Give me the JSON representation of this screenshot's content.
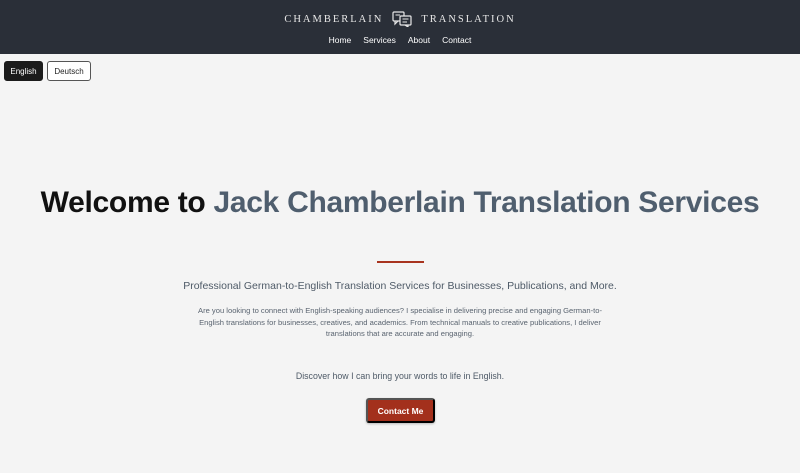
{
  "header": {
    "logo_left": "CHAMBERLAIN",
    "logo_right": "TRANSLATION",
    "logo_icon": "translation-speech-bubbles-icon",
    "nav": [
      "Home",
      "Services",
      "About",
      "Contact"
    ],
    "background": "#2a2f38"
  },
  "language": {
    "english": "English",
    "deutsch": "Deutsch",
    "active": "English"
  },
  "hero": {
    "title_prefix": "Welcome to",
    "title_accent": "Jack Chamberlain Translation Services",
    "subtitle": "Professional German-to-English Translation Services for Businesses, Publications, and More.",
    "body": "Are you looking to connect with English-speaking audiences? I specialise in delivering precise and engaging German-to-English translations for businesses, creatives, and academics. From technical manuals to creative publications, I deliver translations that are accurate and engaging.",
    "discover": "Discover how I can bring your words to life in English.",
    "cta": "Contact Me"
  },
  "colors": {
    "accent_text": "#4f5e6e",
    "brand_red": "#a3301c",
    "page_background": "#f4f4f4"
  }
}
